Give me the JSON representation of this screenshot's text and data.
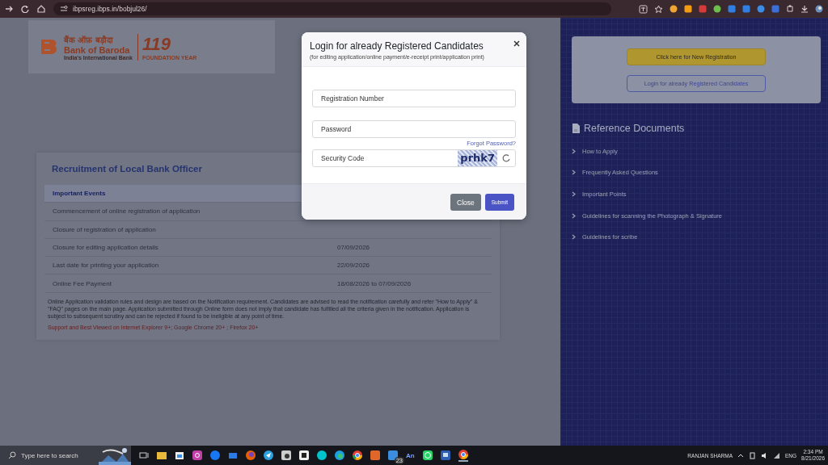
{
  "browser": {
    "url": "ibpsreg.ibps.in/bobjul26/"
  },
  "logo": {
    "hindi": "बैंक ऑफ़ बड़ौदा",
    "name": "Bank of Baroda",
    "tagline": "India's International Bank",
    "year": "119",
    "year_caption": "FOUNDATION YEAR"
  },
  "recruitment": {
    "title": "Recruitment of Local Bank Officer",
    "header": "Important Events",
    "events": [
      {
        "event": "Commencement of online registration of application"
      },
      {
        "event": "Closure of registration of application"
      },
      {
        "event": "Closure for editing application details",
        "date": "07/09/2026"
      },
      {
        "event": "Last date for printing your application",
        "date": "22/09/2026"
      },
      {
        "event": "Online Fee Payment",
        "date": "18/08/2026 to 07/09/2026"
      }
    ],
    "note": "Online Application validation rules and design are based on the Notification requirement. Candidates are advised to read the notification carefully and refer \"How to Apply\" & \"FAQ\" pages on the main page. Application submitted through Online form does not imply that candidate has fulfilled all the criteria given in the notification. Application is subject to subsequent scrutiny and can be rejected if found to be ineligible at any point of time.",
    "support": "Support and Best Viewed on Internet Explorer 9+; Google Chrome 20+ ; Firefox 20+"
  },
  "panel": {
    "buttons": [
      {
        "label": "Click here for New Registration",
        "kind": "primary"
      },
      {
        "label": "Login for already Registered Candidates",
        "kind": "outline"
      }
    ],
    "reference_title": "Reference Documents",
    "links": [
      "How to Apply",
      "Frequently Asked Questions",
      "Important Points",
      "Guidelines for scanning the Photograph & Signature",
      "Guidelines for scribe"
    ]
  },
  "modal": {
    "title": "Login for already Registered Candidates",
    "subtitle": "(for editing application/online payment/e-receipt print/application print)",
    "fields": [
      {
        "placeholder": "Registration Number",
        "kind": "text"
      },
      {
        "placeholder": "Password",
        "kind": "password"
      },
      {
        "placeholder": "Security Code",
        "kind": "captcha"
      }
    ],
    "forgot_link": "Forgot Password?",
    "captcha": "prhk7",
    "buttons": [
      {
        "label": "Close",
        "kind": "secondary"
      },
      {
        "label": "Submit",
        "kind": "primary"
      }
    ]
  },
  "taskbar": {
    "search_placeholder": "Type here to search",
    "badge": "23",
    "app_label": "An",
    "user": "RANJAN SHARMA",
    "language": "ENG",
    "time": "2:34 PM",
    "date": "8/21/2026"
  }
}
